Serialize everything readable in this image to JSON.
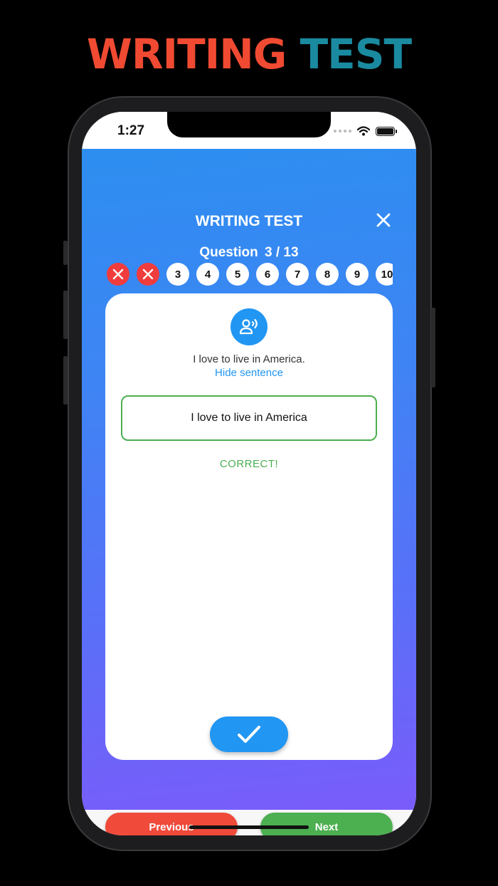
{
  "promo": {
    "word1": "WRITING",
    "word2": "TEST"
  },
  "status_bar": {
    "time": "1:27"
  },
  "header": {
    "title": "WRITING TEST",
    "question_prefix": "Question",
    "question_current": "3 / 13"
  },
  "questions": [
    {
      "label": "",
      "state": "wrong"
    },
    {
      "label": "",
      "state": "wrong"
    },
    {
      "label": "3",
      "state": "current"
    },
    {
      "label": "4",
      "state": "pending"
    },
    {
      "label": "5",
      "state": "pending"
    },
    {
      "label": "6",
      "state": "pending"
    },
    {
      "label": "7",
      "state": "pending"
    },
    {
      "label": "8",
      "state": "pending"
    },
    {
      "label": "9",
      "state": "pending"
    },
    {
      "label": "10",
      "state": "pending"
    }
  ],
  "card": {
    "sentence": "I love to live in America.",
    "hide_label": "Hide sentence",
    "answer_value": "I love to live in America",
    "result": "CORRECT!"
  },
  "nav": {
    "previous_label": "Previous",
    "next_label": "Next"
  },
  "colors": {
    "wrong": "#f03c3c",
    "correct": "#4caf50",
    "accent": "#2196f3",
    "previous": "#f04a3a",
    "next": "#4caf50",
    "promo_red": "#f04a32",
    "promo_teal": "#1a8aa0"
  }
}
